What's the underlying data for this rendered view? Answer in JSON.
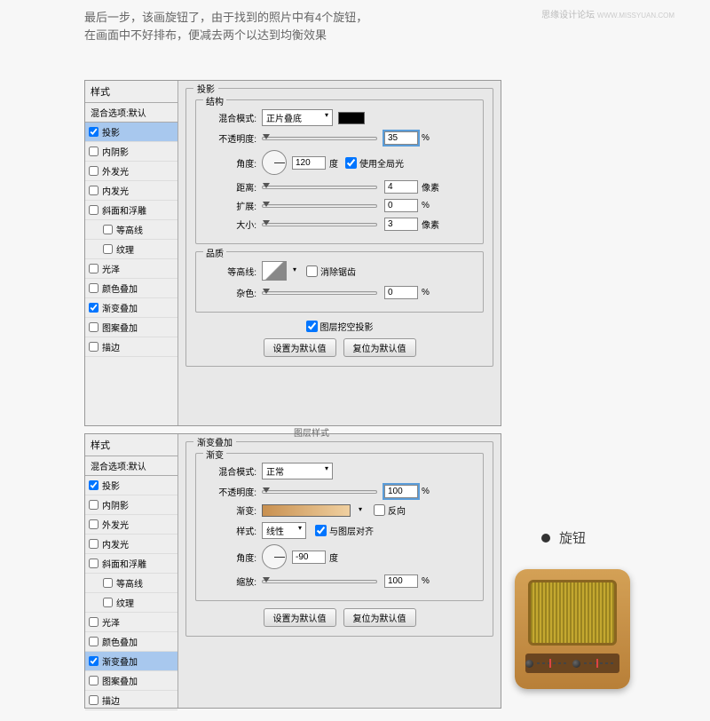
{
  "watermark": {
    "site": "思缘设计论坛",
    "url": "WWW.MISSYUAN.COM"
  },
  "header": {
    "line1": "最后一步，该画旋钮了，由于找到的照片中有4个旋钮，",
    "line2": "在画面中不好排布，便减去两个以达到均衡效果"
  },
  "styles_title": "样式",
  "blending_default": "混合选项:默认",
  "style_items": [
    "投影",
    "内阴影",
    "外发光",
    "内发光",
    "斜面和浮雕",
    "等高线",
    "纹理",
    "光泽",
    "颜色叠加",
    "渐变叠加",
    "图案叠加",
    "描边"
  ],
  "dialog1": {
    "group_title": "投影",
    "struct_title": "结构",
    "blend_mode_label": "混合模式:",
    "blend_mode_value": "正片叠底",
    "opacity_label": "不透明度:",
    "opacity_value": "35",
    "opacity_unit": "%",
    "angle_label": "角度:",
    "angle_value": "120",
    "angle_unit": "度",
    "global_light": "使用全局光",
    "distance_label": "距离:",
    "distance_value": "4",
    "distance_unit": "像素",
    "spread_label": "扩展:",
    "spread_value": "0",
    "spread_unit": "%",
    "size_label": "大小:",
    "size_value": "3",
    "size_unit": "像素",
    "quality_title": "品质",
    "contour_label": "等高线:",
    "antialias": "消除锯齿",
    "noise_label": "杂色:",
    "noise_value": "0",
    "noise_unit": "%",
    "knockout": "图层挖空投影",
    "btn_default": "设置为默认值",
    "btn_reset": "复位为默认值"
  },
  "dialog2": {
    "layer_style_title": "图层样式",
    "group_title": "渐变叠加",
    "sub_title": "渐变",
    "blend_mode_label": "混合模式:",
    "blend_mode_value": "正常",
    "opacity_label": "不透明度:",
    "opacity_value": "100",
    "opacity_unit": "%",
    "gradient_label": "渐变:",
    "reverse": "反向",
    "style_label": "样式:",
    "style_value": "线性",
    "align_layer": "与图层对齐",
    "angle_label": "角度:",
    "angle_value": "-90",
    "angle_unit": "度",
    "scale_label": "缩放:",
    "scale_value": "100",
    "scale_unit": "%",
    "btn_default": "设置为默认值",
    "btn_reset": "复位为默认值"
  },
  "knob": {
    "title": "旋钮"
  }
}
